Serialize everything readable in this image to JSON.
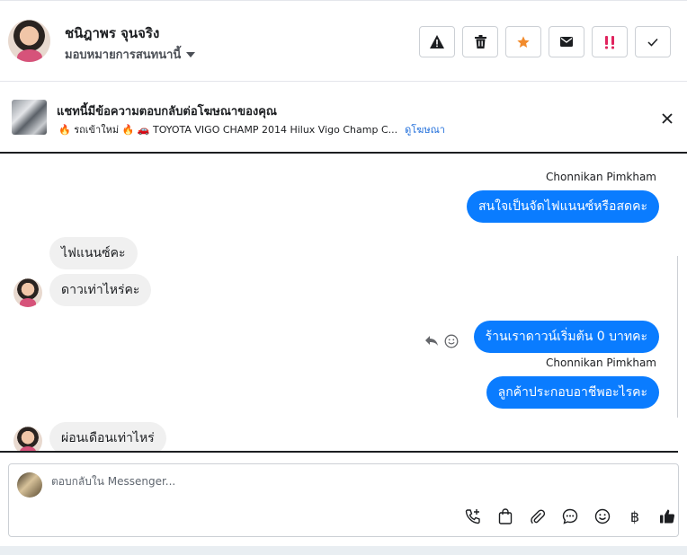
{
  "header": {
    "contact_name": "ชนิฎาพร จุนจริง",
    "assign_label": "มอบหมายการสนทนานี้",
    "actions": [
      {
        "icon": "warning-icon",
        "color": "#1c1e21"
      },
      {
        "icon": "trash-icon",
        "color": "#1c1e21"
      },
      {
        "icon": "star-icon",
        "color": "#f28b2c"
      },
      {
        "icon": "mail-icon",
        "color": "#1c1e21"
      },
      {
        "icon": "important-icon",
        "color": "#e0245e"
      },
      {
        "icon": "check-icon",
        "color": "#1c1e21"
      }
    ]
  },
  "ad": {
    "title": "แชทนี้มีข้อความตอบกลับต่อโฆษณาของคุณ",
    "subtitle": "🔥 รถเข้าใหม่ 🔥 🚗 TOYOTA VIGO CHAMP 2014 Hilux Vigo Champ C...",
    "link": "ดูโฆษณา"
  },
  "chat": {
    "sender_name": "Chonnikan Pimkham",
    "messages": [
      {
        "dir": "out",
        "text": "สนใจเป็นจัดไฟแนนซ์หรือสดคะ"
      },
      {
        "dir": "in",
        "text": "ไฟแนนซ์คะ"
      },
      {
        "dir": "in",
        "text": "ดาวเท่าไหร่คะ"
      },
      {
        "dir": "out",
        "text": "ร้านเราดาวน์เริ่มต้น 0 บาทคะ"
      },
      {
        "dir": "out",
        "text": "ลูกค้าประกอบอาชีพอะไรคะ"
      },
      {
        "dir": "in",
        "text": "ผ่อนเดือนเท่าไหร่"
      }
    ]
  },
  "composer": {
    "placeholder": "ตอบกลับใน Messenger...",
    "tools": [
      "call-add-icon",
      "shopping-bag-icon",
      "attachment-icon",
      "chat-bubble-icon",
      "emoji-icon",
      "baht-icon",
      "thumbs-up-icon"
    ],
    "baht_symbol": "฿"
  },
  "colors": {
    "outgoing_bubble": "#0a7cff",
    "incoming_bubble": "#f0f0f0",
    "link": "#216fdb"
  }
}
